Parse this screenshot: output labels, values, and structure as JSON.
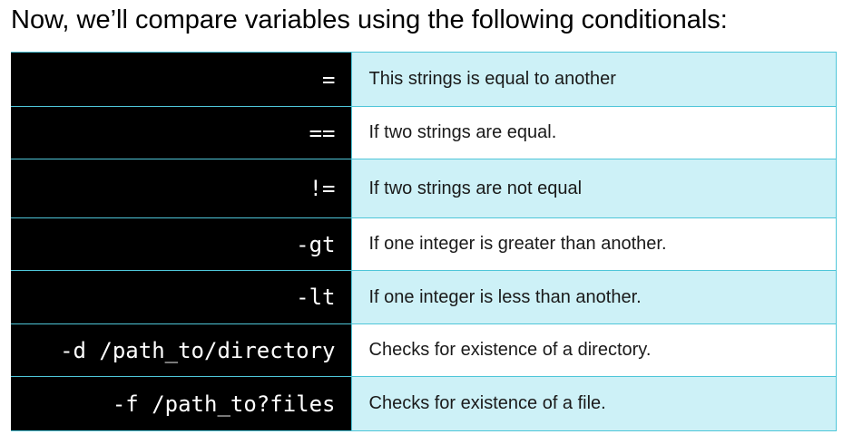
{
  "heading": "Now, we’ll compare variables using the following conditionals:",
  "colors": {
    "operator_bg": "#000000",
    "operator_text": "#ffffff",
    "tinted_row": "#cdf1f7",
    "border": "#4fc6d9"
  },
  "rows": [
    {
      "operator": "=",
      "description": "This strings is equal to another"
    },
    {
      "operator": "==",
      "description": "If two strings are equal."
    },
    {
      "operator": "!=",
      "description": "If two strings are not equal"
    },
    {
      "operator": "-gt",
      "description": "If one integer is greater than another."
    },
    {
      "operator": "-lt",
      "description": "If one integer is less than another."
    },
    {
      "operator": "-d /path_to/directory",
      "description": "Checks for existence of a directory."
    },
    {
      "operator": "-f /path_to?files",
      "description": "Checks for existence of a file."
    }
  ]
}
